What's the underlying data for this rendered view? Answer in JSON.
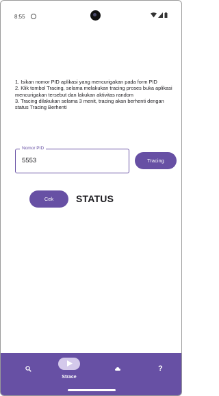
{
  "status_bar": {
    "time": "8:55"
  },
  "instructions": [
    "1. Isikan nomor PID aplikasi yang mencurigakan pada form PID",
    "2. Klik tombol Tracing, selama melakukan tracing proses buka aplikasi mencurigakan tersebut dan lakukan aktivitas random",
    "3. Tracing dilakukan selama 3 menit, tracing akan berhenti dengan status Tracing Berhenti"
  ],
  "pid_field": {
    "label": "Nomor PID",
    "value": "5553"
  },
  "buttons": {
    "tracing": "Tracing",
    "cek": "Cek"
  },
  "status_text": "STATUS",
  "bottom_nav": {
    "items": [
      {
        "icon": "search-icon",
        "label": ""
      },
      {
        "icon": "play-icon",
        "label": "Strace",
        "selected": true
      },
      {
        "icon": "cloud-icon",
        "label": ""
      },
      {
        "icon": "help-icon",
        "label": "?"
      }
    ]
  },
  "colors": {
    "primary": "#6750a4",
    "on_primary": "#ffffff",
    "selected_indicator": "#e8def8"
  }
}
